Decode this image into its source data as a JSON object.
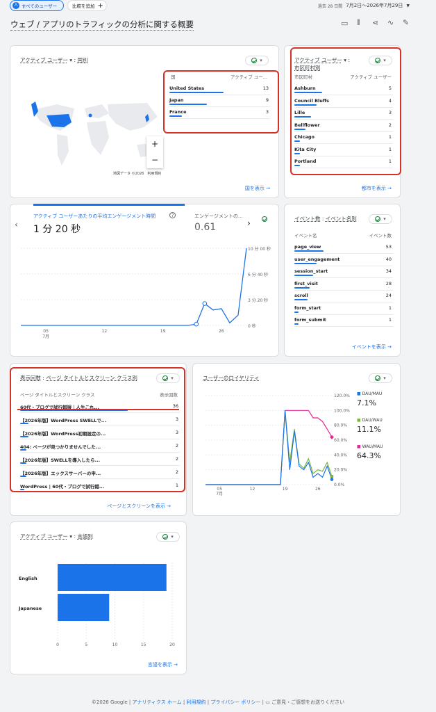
{
  "topbar": {
    "segment": "すべてのユーザー",
    "add_compare": "比較を追加",
    "date_prefix": "過去 28 日間",
    "date_range": "7月2日～2026年7月29日"
  },
  "page_title": "ウェブ / アプリのトラフィックの分析に関する概要",
  "map_card": {
    "title_metric": "アクティブ ユーザー",
    "title_dim": "国別",
    "col1": "国",
    "col2": "アクティブ ユー...",
    "rows": [
      {
        "name": "United States",
        "value": "13",
        "frac": 1.0
      },
      {
        "name": "Japan",
        "value": "9",
        "frac": 0.69
      },
      {
        "name": "France",
        "value": "3",
        "frac": 0.23
      }
    ],
    "attribution": "地図データ ©2026　利用規約",
    "zoom_in": "+",
    "zoom_out": "−",
    "link": "国を表示"
  },
  "city_card": {
    "title_metric": "アクティブ ユーザー",
    "title_dim": "市区町村別",
    "col1": "市区町村",
    "col2": "アクティブ ユーザー",
    "rows": [
      {
        "name": "Ashburn",
        "value": "5",
        "frac": 1.0
      },
      {
        "name": "Council Bluffs",
        "value": "4",
        "frac": 0.8
      },
      {
        "name": "Lille",
        "value": "3",
        "frac": 0.6
      },
      {
        "name": "Bellflower",
        "value": "2",
        "frac": 0.4
      },
      {
        "name": "Chicago",
        "value": "1",
        "frac": 0.2
      },
      {
        "name": "Kita City",
        "value": "1",
        "frac": 0.2
      },
      {
        "name": "Portland",
        "value": "1",
        "frac": 0.2
      }
    ],
    "link": "都市を表示"
  },
  "engagement_card": {
    "metric1_label": "アクティブ ユーザーあたりの平均エンゲージメント時間",
    "metric1_value": "1 分 20 秒",
    "metric2_label": "エンゲージメントの...",
    "metric2_value": "0.61"
  },
  "events_card": {
    "title_metric": "イベント数",
    "title_dim": "イベント名別",
    "col1": "イベント名",
    "col2": "イベント数",
    "rows": [
      {
        "name": "page_view",
        "value": "53",
        "frac": 1.0
      },
      {
        "name": "user_engagement",
        "value": "40",
        "frac": 0.75
      },
      {
        "name": "session_start",
        "value": "34",
        "frac": 0.64
      },
      {
        "name": "first_visit",
        "value": "28",
        "frac": 0.53
      },
      {
        "name": "scroll",
        "value": "24",
        "frac": 0.45
      },
      {
        "name": "form_start",
        "value": "1",
        "frac": 0.02
      },
      {
        "name": "form_submit",
        "value": "1",
        "frac": 0.02
      }
    ],
    "link": "イベントを表示"
  },
  "pages_card": {
    "title_metric": "表示回数",
    "title_dim": "ページ タイトルとスクリーン クラス別",
    "col1": "ページ タイトルとスクリーン クラス",
    "col2": "表示回数",
    "rows": [
      {
        "name": "60代・ブログで試行錯誤｜人生これ...",
        "value": "36",
        "frac": 1.0
      },
      {
        "name": "【2026年版】WordPress SWELLで...",
        "value": "3",
        "frac": 0.08
      },
      {
        "name": "【2026年版】WordPress初期設定の...",
        "value": "3",
        "frac": 0.08
      },
      {
        "name": "404: ページが見つかりませんでした...",
        "value": "2",
        "frac": 0.06
      },
      {
        "name": "【2026年版】SWELLを導入したら...",
        "value": "2",
        "frac": 0.06
      },
      {
        "name": "【2026年版】エックスサーバーの申...",
        "value": "2",
        "frac": 0.06
      },
      {
        "name": "WordPress | 60代・ブログで試行錯...",
        "value": "1",
        "frac": 0.03
      }
    ],
    "link": "ページとスクリーンを表示"
  },
  "loyalty_card": {
    "title": "ユーザーのロイヤリティ",
    "legend": [
      {
        "name": "DAU/MAU",
        "value": "7.1%",
        "color": "#1a73e8"
      },
      {
        "name": "DAU/WAU",
        "value": "11.1%",
        "color": "#7cb342"
      },
      {
        "name": "WAU/MAU",
        "value": "64.3%",
        "color": "#e52592"
      }
    ]
  },
  "lang_card": {
    "title_metric": "アクティブ ユーザー",
    "title_dim": "言語別",
    "link": "言語を表示"
  },
  "footer": {
    "copyright": "©2026 Google",
    "links": [
      "アナリティクス ホーム",
      "利用規約",
      "プライバシー ポリシー"
    ],
    "feedback": "ご意見・ご感想をお送りください"
  },
  "chart_data": [
    {
      "type": "line",
      "title": "",
      "x": [
        "07-02",
        "07-03",
        "07-04",
        "07-05",
        "07-06",
        "07-07",
        "07-08",
        "07-09",
        "07-10",
        "07-11",
        "07-12",
        "07-13",
        "07-14",
        "07-15",
        "07-16",
        "07-17",
        "07-18",
        "07-19",
        "07-20",
        "07-21",
        "07-22",
        "07-23",
        "07-24",
        "07-25",
        "07-26",
        "07-27",
        "07-28",
        "07-29"
      ],
      "x_ticks": [
        "05\n7月",
        "12",
        "19",
        "26"
      ],
      "series": [
        {
          "values": [
            0,
            0,
            0,
            0,
            0,
            0,
            0,
            0,
            0,
            0,
            0,
            0,
            0,
            0,
            0,
            0,
            0,
            0,
            0,
            0,
            0,
            10,
            170,
            120,
            130,
            20,
            80,
            600
          ]
        }
      ],
      "y_ticks": [
        "0 秒",
        "3 分 20 秒",
        "6 分 40 秒",
        "10 分 00 秒"
      ],
      "ylim": [
        0,
        600
      ],
      "color": "#1a73e8"
    },
    {
      "type": "line",
      "x": [
        "07-02",
        "07-03",
        "07-04",
        "07-05",
        "07-06",
        "07-07",
        "07-08",
        "07-09",
        "07-10",
        "07-11",
        "07-12",
        "07-13",
        "07-14",
        "07-15",
        "07-16",
        "07-17",
        "07-18",
        "07-19",
        "07-20",
        "07-21",
        "07-22",
        "07-23",
        "07-24",
        "07-25",
        "07-26",
        "07-27",
        "07-28",
        "07-29"
      ],
      "x_ticks": [
        "05\n7月",
        "12",
        "19",
        "26"
      ],
      "y_ticks": [
        "0.0%",
        "20.0%",
        "40.0%",
        "60.0%",
        "80.0%",
        "100.0%",
        "120.0%"
      ],
      "ylim": [
        0,
        120
      ],
      "series": [
        {
          "name": "DAU/MAU",
          "color": "#1a73e8",
          "values": [
            0,
            0,
            0,
            0,
            0,
            0,
            0,
            0,
            0,
            0,
            0,
            0,
            0,
            0,
            0,
            0,
            0,
            100,
            20,
            72,
            25,
            20,
            30,
            10,
            15,
            10,
            25,
            7
          ]
        },
        {
          "name": "DAU/WAU",
          "color": "#7cb342",
          "values": [
            0,
            0,
            0,
            0,
            0,
            0,
            0,
            0,
            0,
            0,
            0,
            0,
            0,
            0,
            0,
            0,
            0,
            100,
            30,
            75,
            28,
            22,
            35,
            15,
            20,
            18,
            30,
            11
          ]
        },
        {
          "name": "WAU/MAU",
          "color": "#e52592",
          "values": [
            0,
            0,
            0,
            0,
            0,
            0,
            0,
            0,
            0,
            0,
            0,
            0,
            0,
            0,
            0,
            0,
            0,
            100,
            100,
            100,
            100,
            100,
            100,
            90,
            90,
            85,
            75,
            64
          ]
        }
      ]
    },
    {
      "type": "bar",
      "orientation": "horizontal",
      "categories": [
        "English",
        "Japanese"
      ],
      "values": [
        19,
        9
      ],
      "x_ticks": [
        "0",
        "5",
        "10",
        "15",
        "20"
      ],
      "xlim": [
        0,
        20
      ],
      "color": "#1a73e8"
    }
  ]
}
